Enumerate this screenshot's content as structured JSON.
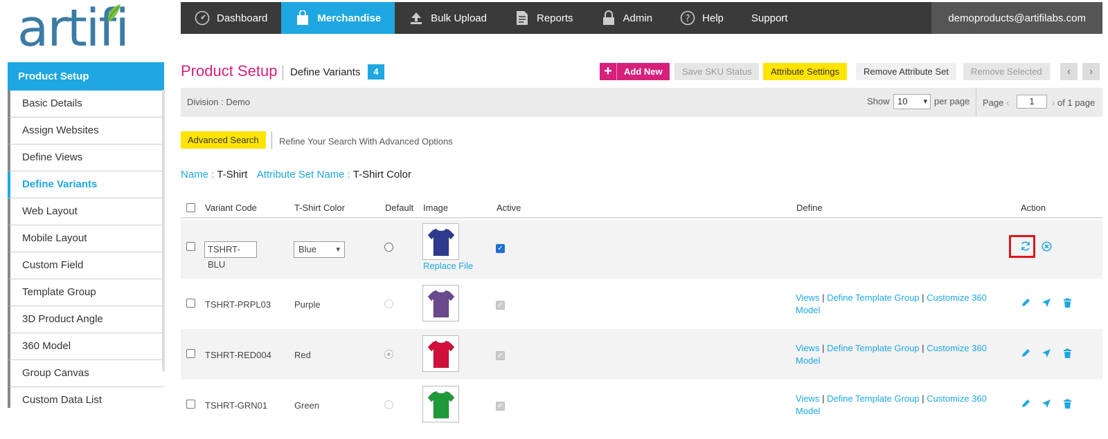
{
  "logo": {
    "text": "artifi"
  },
  "nav": {
    "items": [
      {
        "label": "Dashboard",
        "icon": "dashboard-icon"
      },
      {
        "label": "Merchandise",
        "icon": "shopping-bag-icon"
      },
      {
        "label": "Bulk Upload",
        "icon": "upload-icon"
      },
      {
        "label": "Reports",
        "icon": "document-icon"
      },
      {
        "label": "Admin",
        "icon": "lock-icon"
      },
      {
        "label": "Help",
        "icon": "help-icon"
      },
      {
        "label": "Support",
        "icon": ""
      }
    ],
    "active": "Merchandise",
    "user": "demoproducts@artifilabs.com"
  },
  "sidebar": {
    "header": "Product Setup",
    "items": [
      {
        "label": "Basic Details"
      },
      {
        "label": "Assign Websites"
      },
      {
        "label": "Define Views"
      },
      {
        "label": "Define Variants"
      },
      {
        "label": "Web Layout"
      },
      {
        "label": "Mobile Layout"
      },
      {
        "label": "Custom Field"
      },
      {
        "label": "Template Group"
      },
      {
        "label": "3D Product Angle"
      },
      {
        "label": "360 Model"
      },
      {
        "label": "Group Canvas"
      },
      {
        "label": "Custom Data List"
      }
    ],
    "active": "Define Variants"
  },
  "header": {
    "title": "Product Setup",
    "subtitle": "Define Variants",
    "count": "4"
  },
  "toolbar": {
    "add_plus": "+",
    "add_new": "Add New",
    "save_sku": "Save SKU Status",
    "attribute_settings": "Attribute Settings",
    "remove_attribute_set": "Remove Attribute Set",
    "remove_selected": "Remove Selected",
    "prev": "‹",
    "next": "›"
  },
  "filter": {
    "division": "Division :  Demo",
    "show": "Show",
    "per_page_value": "10",
    "per_page": "per page",
    "page": "Page",
    "page_value": "1",
    "of_pages": "of 1 page"
  },
  "search": {
    "advanced": "Advanced Search",
    "refine": "Refine Your Search With Advanced Options"
  },
  "info": {
    "name_key": "Name : ",
    "name_val": "T-Shirt",
    "attr_key": "Attribute Set Name : ",
    "attr_val": "T-Shirt Color"
  },
  "table": {
    "columns": {
      "code": "Variant Code",
      "color": "T-Shirt Color",
      "default": "Default",
      "image": "Image",
      "active": "Active",
      "define": "Define",
      "action": "Action"
    },
    "rows": [
      {
        "code": "TSHRT-BLU",
        "color": "Blue",
        "shirt_color": "#2e3a8c",
        "replace": "Replace File",
        "editing": true
      },
      {
        "code": "TSHRT-PRPL03",
        "color": "Purple",
        "shirt_color": "#6a4a8c",
        "views": "Views",
        "template": "Define Template Group",
        "customize": "Customize 360",
        "model": "Model"
      },
      {
        "code": "TSHRT-RED004",
        "color": "Red",
        "shirt_color": "#d0103a",
        "views": "Views",
        "template": "Define Template Group",
        "customize": "Customize 360",
        "model": "Model"
      },
      {
        "code": "TSHRT-GRN01",
        "color": "Green",
        "shirt_color": "#1f9a3a",
        "views": "Views",
        "template": "Define Template Group",
        "customize": "Customize 360",
        "model": "Model"
      }
    ]
  },
  "colors": {
    "accent": "#1ea7e1",
    "brand_pink": "#d6207c",
    "yellow": "#ffe400",
    "highlight": "#e0141e"
  }
}
